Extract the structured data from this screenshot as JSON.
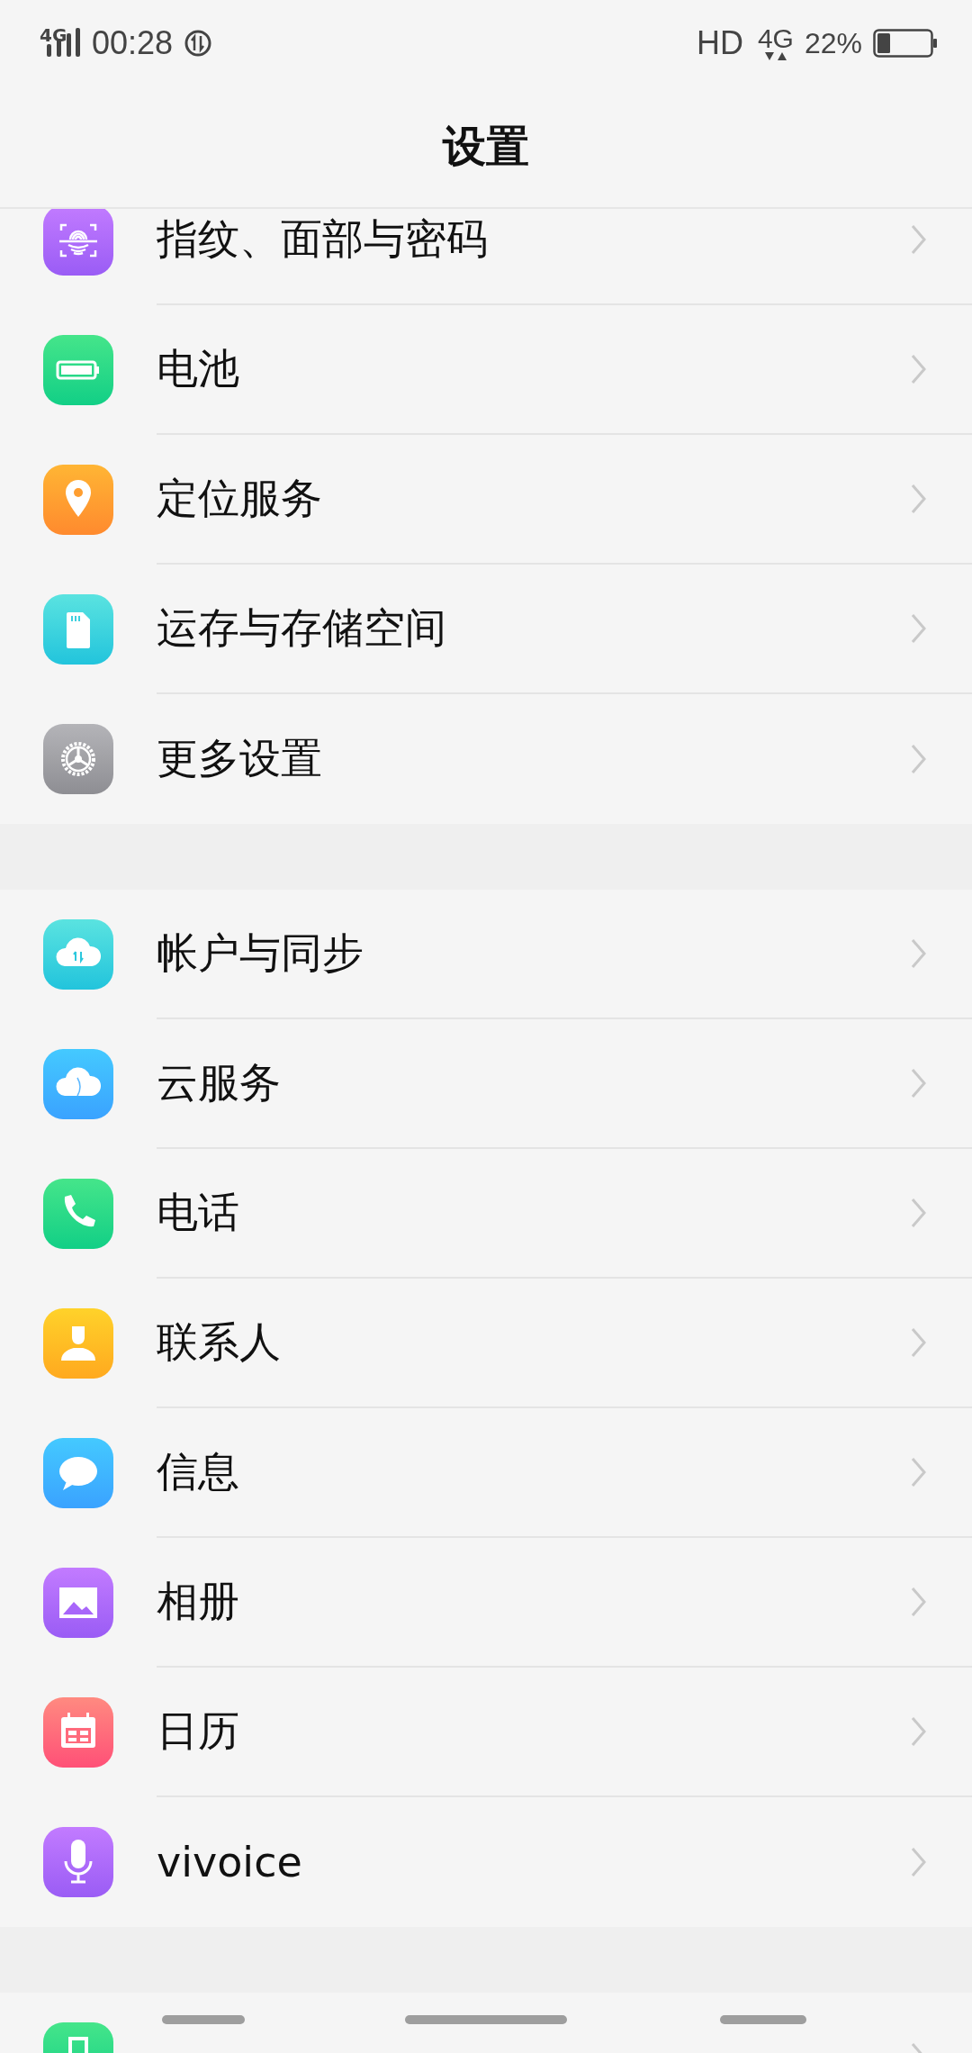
{
  "status_bar": {
    "network": "4G",
    "time": "00:28",
    "hd": "HD",
    "data_network": "4G",
    "battery": "22%"
  },
  "title": "设置",
  "sections": [
    {
      "items": [
        {
          "label": "指纹、面部与密码"
        },
        {
          "label": "电池"
        },
        {
          "label": "定位服务"
        },
        {
          "label": "运存与存储空间"
        },
        {
          "label": "更多设置"
        }
      ]
    },
    {
      "items": [
        {
          "label": "帐户与同步"
        },
        {
          "label": "云服务"
        },
        {
          "label": "电话"
        },
        {
          "label": "联系人"
        },
        {
          "label": "信息"
        },
        {
          "label": "相册"
        },
        {
          "label": "日历"
        },
        {
          "label": "vivoice"
        }
      ]
    }
  ]
}
